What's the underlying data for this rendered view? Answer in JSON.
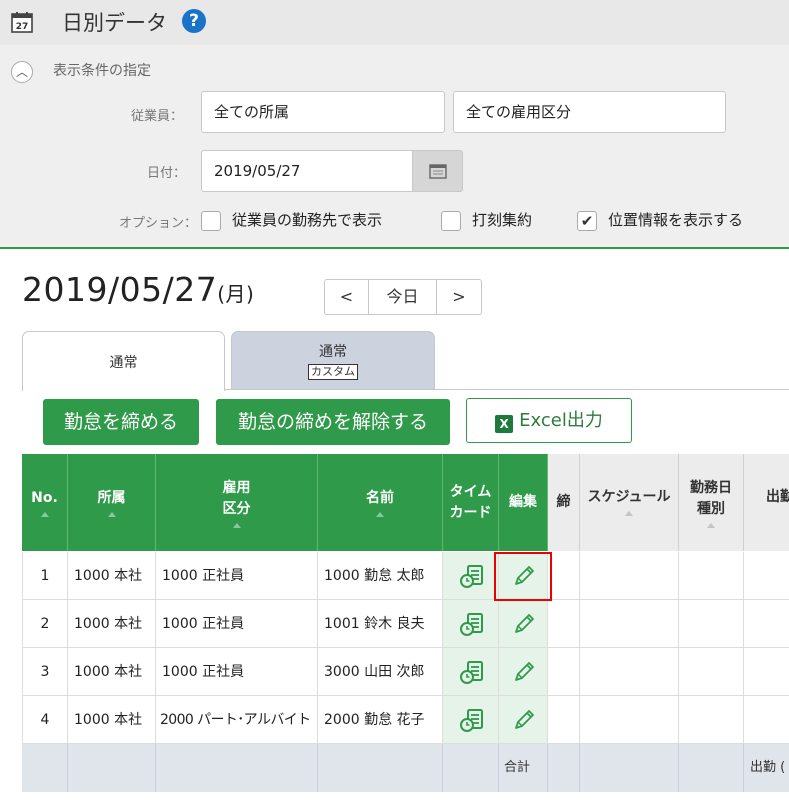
{
  "header": {
    "title": "日別データ",
    "help": "?"
  },
  "filter": {
    "heading": "表示条件の指定",
    "employee_label": "従業員：",
    "dept_value": "全ての所属",
    "employment_value": "全ての雇用区分",
    "date_label": "日付：",
    "date_value": "2019/05/27",
    "option_label": "オプション：",
    "options": [
      {
        "label": "従業員の勤務先で表示",
        "checked": false
      },
      {
        "label": "打刻集約",
        "checked": false
      },
      {
        "label": "位置情報を表示する",
        "checked": true
      }
    ]
  },
  "date_header": {
    "date": "2019/05/27",
    "weekday": "(月)"
  },
  "nav": {
    "prev": "<",
    "today": "今日",
    "next": ">"
  },
  "tabs": [
    {
      "label": "通常",
      "tag": ""
    },
    {
      "label": "通常",
      "tag": "カスタム"
    }
  ],
  "actions": {
    "close": "勤怠を締める",
    "unlock": "勤怠の締めを解除する",
    "excel": "Excel出力",
    "excel_icon": "X"
  },
  "table": {
    "headers": {
      "no": "No.",
      "dept": "所属",
      "emp1": "雇用",
      "emp2": "区分",
      "name": "名前",
      "tc1": "タイム",
      "tc2": "カード",
      "edit": "編集",
      "lock": "締",
      "schedule": "スケジュール",
      "wd1": "勤務日",
      "wd2": "種別",
      "att": "出勤"
    },
    "rows": [
      {
        "no": "1",
        "dept": "1000 本社",
        "emp": "1000 正社員",
        "name": "1000 勤怠 太郎"
      },
      {
        "no": "2",
        "dept": "1000 本社",
        "emp": "1000 正社員",
        "name": "1001 鈴木 良夫"
      },
      {
        "no": "3",
        "dept": "1000 本社",
        "emp": "1000 正社員",
        "name": "3000 山田 次郎"
      },
      {
        "no": "4",
        "dept": "1000 本社",
        "emp": "2000 パート･アルバイト",
        "name": "2000 勤怠 花子"
      }
    ],
    "footer": {
      "total": "合計",
      "att": "出勤 ("
    }
  },
  "colors": {
    "accent": "#2e9a4a",
    "highlight": "#e00000"
  }
}
